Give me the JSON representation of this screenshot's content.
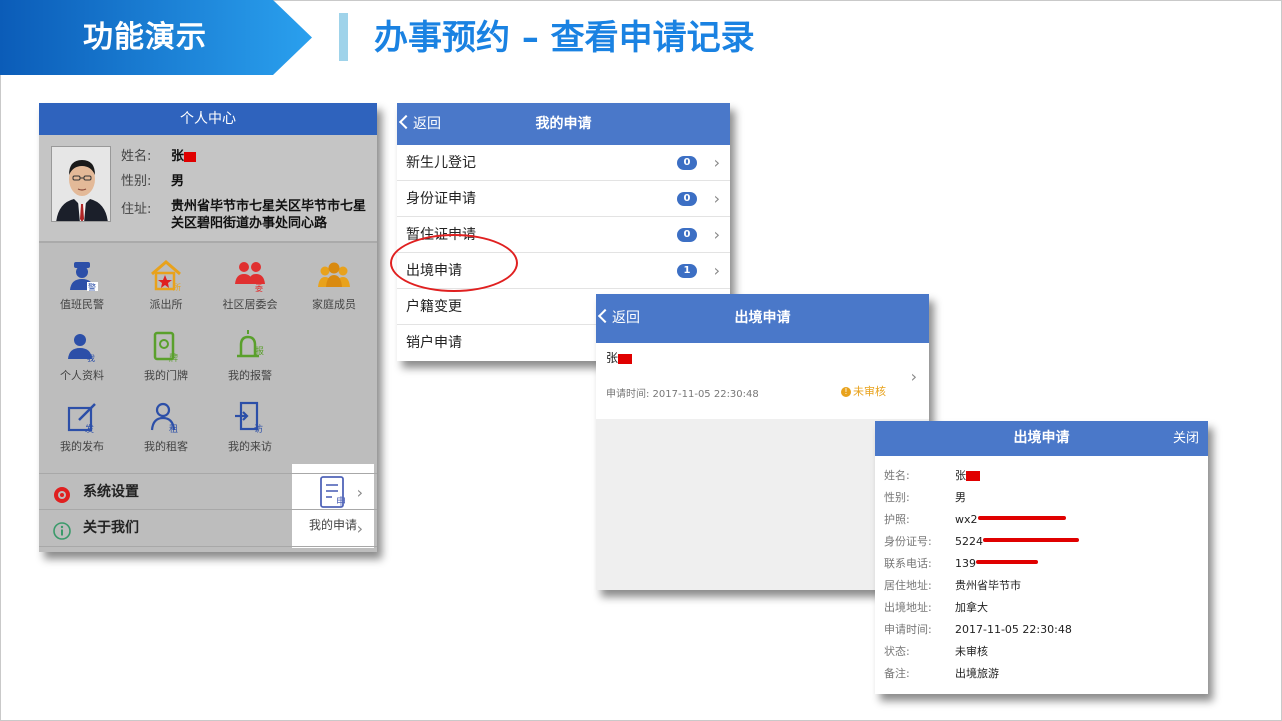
{
  "header": {
    "tag": "功能演示",
    "title": "办事预约 – 查看申请记录",
    "colors": {
      "tag_from": "#0b5cb8",
      "tag_to": "#2aa0ee",
      "title": "#1a82e2",
      "bar": "#9fd3ea"
    }
  },
  "personal_center": {
    "title": "个人中心",
    "name_label": "姓名:",
    "name_value": "张",
    "gender_label": "性别:",
    "gender_value": "男",
    "address_label": "住址:",
    "address_value": "贵州省毕节市七星关区毕节市七星关区碧阳街道办事处同心路",
    "grid": [
      {
        "label": "值班民警",
        "icon": "police-icon"
      },
      {
        "label": "派出所",
        "icon": "police-station-icon"
      },
      {
        "label": "社区居委会",
        "icon": "community-committee-icon"
      },
      {
        "label": "家庭成员",
        "icon": "family-members-icon"
      },
      {
        "label": "个人资料",
        "icon": "personal-info-icon"
      },
      {
        "label": "我的门牌",
        "icon": "door-plate-icon"
      },
      {
        "label": "我的报警",
        "icon": "alarm-icon"
      },
      {
        "label": "我的申请",
        "icon": "application-icon"
      },
      {
        "label": "我的发布",
        "icon": "publish-icon"
      },
      {
        "label": "我的租客",
        "icon": "tenant-icon"
      },
      {
        "label": "我的来访",
        "icon": "visitor-icon"
      }
    ],
    "list": [
      {
        "label": "系统设置",
        "icon": "settings-icon"
      },
      {
        "label": "关于我们",
        "icon": "info-icon"
      }
    ]
  },
  "my_applications": {
    "back": "返回",
    "title": "我的申请",
    "items": [
      {
        "label": "新生儿登记",
        "count": "0"
      },
      {
        "label": "身份证申请",
        "count": "0"
      },
      {
        "label": "暂住证申请",
        "count": "0"
      },
      {
        "label": "出境申请",
        "count": "1"
      },
      {
        "label": "户籍变更",
        "count": ""
      },
      {
        "label": "销户申请",
        "count": ""
      }
    ]
  },
  "exit_list": {
    "back": "返回",
    "title": "出境申请",
    "item": {
      "name": "张",
      "time": "申请时间: 2017-11-05 22:30:48",
      "status": "未审核"
    }
  },
  "exit_detail": {
    "title": "出境申请",
    "close": "关闭",
    "fields": [
      {
        "label": "姓名:",
        "value": "张"
      },
      {
        "label": "性别:",
        "value": "男"
      },
      {
        "label": "护照:",
        "value": "wx2"
      },
      {
        "label": "身份证号:",
        "value": "5224"
      },
      {
        "label": "联系电话:",
        "value": "139"
      },
      {
        "label": "居住地址:",
        "value": "贵州省毕节市"
      },
      {
        "label": "出境地址:",
        "value": "加拿大"
      },
      {
        "label": "申请时间:",
        "value": "2017-11-05 22:30:48"
      },
      {
        "label": "状态:",
        "value": "未审核"
      },
      {
        "label": "备注:",
        "value": "出境旅游"
      }
    ]
  }
}
